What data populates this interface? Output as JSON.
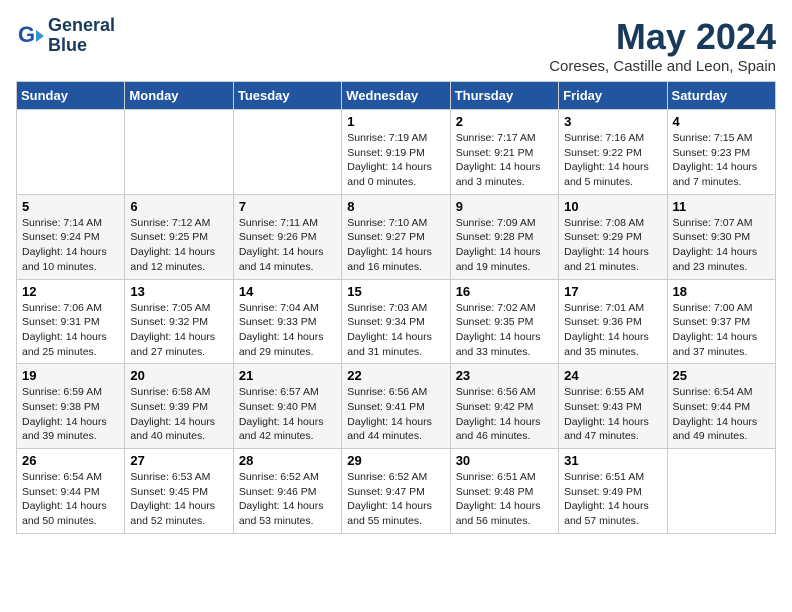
{
  "header": {
    "logo_line1": "General",
    "logo_line2": "Blue",
    "month": "May 2024",
    "location": "Coreses, Castille and Leon, Spain"
  },
  "weekdays": [
    "Sunday",
    "Monday",
    "Tuesday",
    "Wednesday",
    "Thursday",
    "Friday",
    "Saturday"
  ],
  "weeks": [
    [
      {
        "day": "",
        "info": ""
      },
      {
        "day": "",
        "info": ""
      },
      {
        "day": "",
        "info": ""
      },
      {
        "day": "1",
        "info": "Sunrise: 7:19 AM\nSunset: 9:19 PM\nDaylight: 14 hours\nand 0 minutes."
      },
      {
        "day": "2",
        "info": "Sunrise: 7:17 AM\nSunset: 9:21 PM\nDaylight: 14 hours\nand 3 minutes."
      },
      {
        "day": "3",
        "info": "Sunrise: 7:16 AM\nSunset: 9:22 PM\nDaylight: 14 hours\nand 5 minutes."
      },
      {
        "day": "4",
        "info": "Sunrise: 7:15 AM\nSunset: 9:23 PM\nDaylight: 14 hours\nand 7 minutes."
      }
    ],
    [
      {
        "day": "5",
        "info": "Sunrise: 7:14 AM\nSunset: 9:24 PM\nDaylight: 14 hours\nand 10 minutes."
      },
      {
        "day": "6",
        "info": "Sunrise: 7:12 AM\nSunset: 9:25 PM\nDaylight: 14 hours\nand 12 minutes."
      },
      {
        "day": "7",
        "info": "Sunrise: 7:11 AM\nSunset: 9:26 PM\nDaylight: 14 hours\nand 14 minutes."
      },
      {
        "day": "8",
        "info": "Sunrise: 7:10 AM\nSunset: 9:27 PM\nDaylight: 14 hours\nand 16 minutes."
      },
      {
        "day": "9",
        "info": "Sunrise: 7:09 AM\nSunset: 9:28 PM\nDaylight: 14 hours\nand 19 minutes."
      },
      {
        "day": "10",
        "info": "Sunrise: 7:08 AM\nSunset: 9:29 PM\nDaylight: 14 hours\nand 21 minutes."
      },
      {
        "day": "11",
        "info": "Sunrise: 7:07 AM\nSunset: 9:30 PM\nDaylight: 14 hours\nand 23 minutes."
      }
    ],
    [
      {
        "day": "12",
        "info": "Sunrise: 7:06 AM\nSunset: 9:31 PM\nDaylight: 14 hours\nand 25 minutes."
      },
      {
        "day": "13",
        "info": "Sunrise: 7:05 AM\nSunset: 9:32 PM\nDaylight: 14 hours\nand 27 minutes."
      },
      {
        "day": "14",
        "info": "Sunrise: 7:04 AM\nSunset: 9:33 PM\nDaylight: 14 hours\nand 29 minutes."
      },
      {
        "day": "15",
        "info": "Sunrise: 7:03 AM\nSunset: 9:34 PM\nDaylight: 14 hours\nand 31 minutes."
      },
      {
        "day": "16",
        "info": "Sunrise: 7:02 AM\nSunset: 9:35 PM\nDaylight: 14 hours\nand 33 minutes."
      },
      {
        "day": "17",
        "info": "Sunrise: 7:01 AM\nSunset: 9:36 PM\nDaylight: 14 hours\nand 35 minutes."
      },
      {
        "day": "18",
        "info": "Sunrise: 7:00 AM\nSunset: 9:37 PM\nDaylight: 14 hours\nand 37 minutes."
      }
    ],
    [
      {
        "day": "19",
        "info": "Sunrise: 6:59 AM\nSunset: 9:38 PM\nDaylight: 14 hours\nand 39 minutes."
      },
      {
        "day": "20",
        "info": "Sunrise: 6:58 AM\nSunset: 9:39 PM\nDaylight: 14 hours\nand 40 minutes."
      },
      {
        "day": "21",
        "info": "Sunrise: 6:57 AM\nSunset: 9:40 PM\nDaylight: 14 hours\nand 42 minutes."
      },
      {
        "day": "22",
        "info": "Sunrise: 6:56 AM\nSunset: 9:41 PM\nDaylight: 14 hours\nand 44 minutes."
      },
      {
        "day": "23",
        "info": "Sunrise: 6:56 AM\nSunset: 9:42 PM\nDaylight: 14 hours\nand 46 minutes."
      },
      {
        "day": "24",
        "info": "Sunrise: 6:55 AM\nSunset: 9:43 PM\nDaylight: 14 hours\nand 47 minutes."
      },
      {
        "day": "25",
        "info": "Sunrise: 6:54 AM\nSunset: 9:44 PM\nDaylight: 14 hours\nand 49 minutes."
      }
    ],
    [
      {
        "day": "26",
        "info": "Sunrise: 6:54 AM\nSunset: 9:44 PM\nDaylight: 14 hours\nand 50 minutes."
      },
      {
        "day": "27",
        "info": "Sunrise: 6:53 AM\nSunset: 9:45 PM\nDaylight: 14 hours\nand 52 minutes."
      },
      {
        "day": "28",
        "info": "Sunrise: 6:52 AM\nSunset: 9:46 PM\nDaylight: 14 hours\nand 53 minutes."
      },
      {
        "day": "29",
        "info": "Sunrise: 6:52 AM\nSunset: 9:47 PM\nDaylight: 14 hours\nand 55 minutes."
      },
      {
        "day": "30",
        "info": "Sunrise: 6:51 AM\nSunset: 9:48 PM\nDaylight: 14 hours\nand 56 minutes."
      },
      {
        "day": "31",
        "info": "Sunrise: 6:51 AM\nSunset: 9:49 PM\nDaylight: 14 hours\nand 57 minutes."
      },
      {
        "day": "",
        "info": ""
      }
    ]
  ]
}
